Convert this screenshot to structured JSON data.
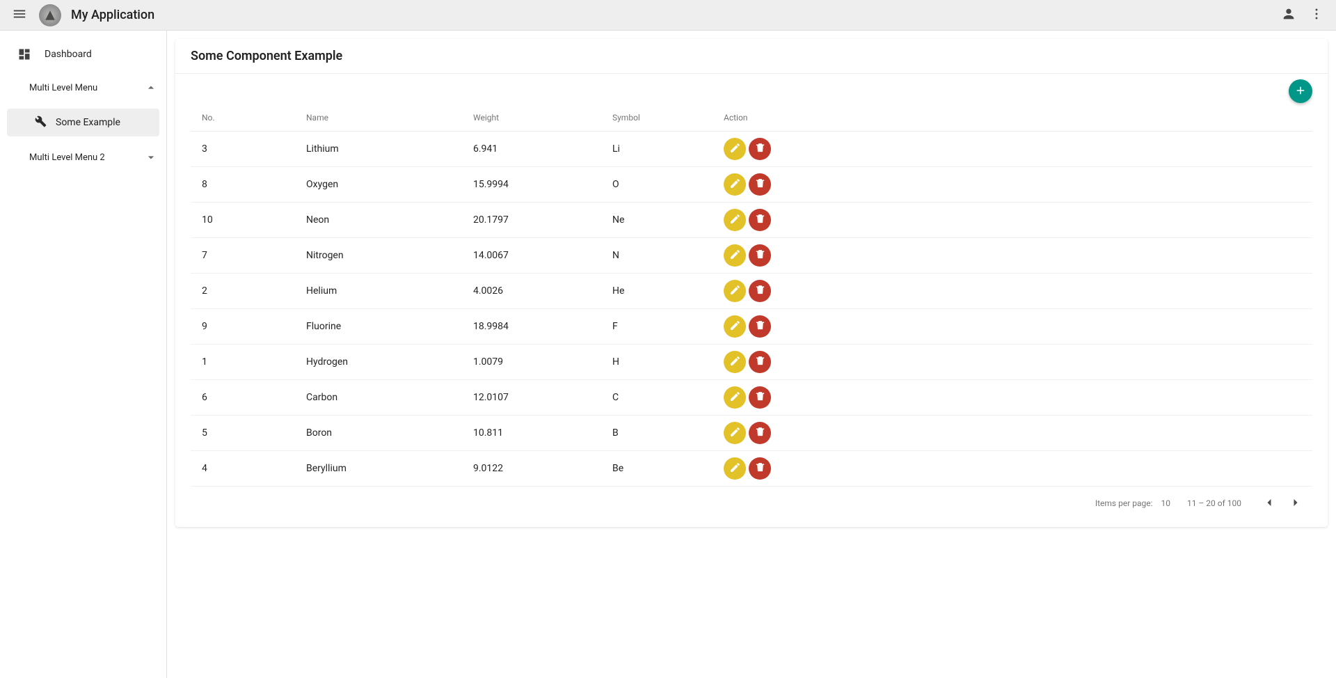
{
  "header": {
    "app_title": "My Application"
  },
  "sidebar": {
    "dashboard_label": "Dashboard",
    "multi1_label": "Multi Level Menu",
    "some_example_label": "Some Example",
    "multi2_label": "Multi Level Menu 2"
  },
  "card": {
    "title": "Some Component Example"
  },
  "table": {
    "columns": {
      "no": "No.",
      "name": "Name",
      "weight": "Weight",
      "symbol": "Symbol",
      "action": "Action"
    },
    "rows": [
      {
        "no": "3",
        "name": "Lithium",
        "weight": "6.941",
        "symbol": "Li"
      },
      {
        "no": "8",
        "name": "Oxygen",
        "weight": "15.9994",
        "symbol": "O"
      },
      {
        "no": "10",
        "name": "Neon",
        "weight": "20.1797",
        "symbol": "Ne"
      },
      {
        "no": "7",
        "name": "Nitrogen",
        "weight": "14.0067",
        "symbol": "N"
      },
      {
        "no": "2",
        "name": "Helium",
        "weight": "4.0026",
        "symbol": "He"
      },
      {
        "no": "9",
        "name": "Fluorine",
        "weight": "18.9984",
        "symbol": "F"
      },
      {
        "no": "1",
        "name": "Hydrogen",
        "weight": "1.0079",
        "symbol": "H"
      },
      {
        "no": "6",
        "name": "Carbon",
        "weight": "12.0107",
        "symbol": "C"
      },
      {
        "no": "5",
        "name": "Boron",
        "weight": "10.811",
        "symbol": "B"
      },
      {
        "no": "4",
        "name": "Beryllium",
        "weight": "9.0122",
        "symbol": "Be"
      }
    ]
  },
  "paginator": {
    "items_per_page_label": "Items per page:",
    "items_per_page_value": "10",
    "range_label": "11 – 20 of 100"
  }
}
